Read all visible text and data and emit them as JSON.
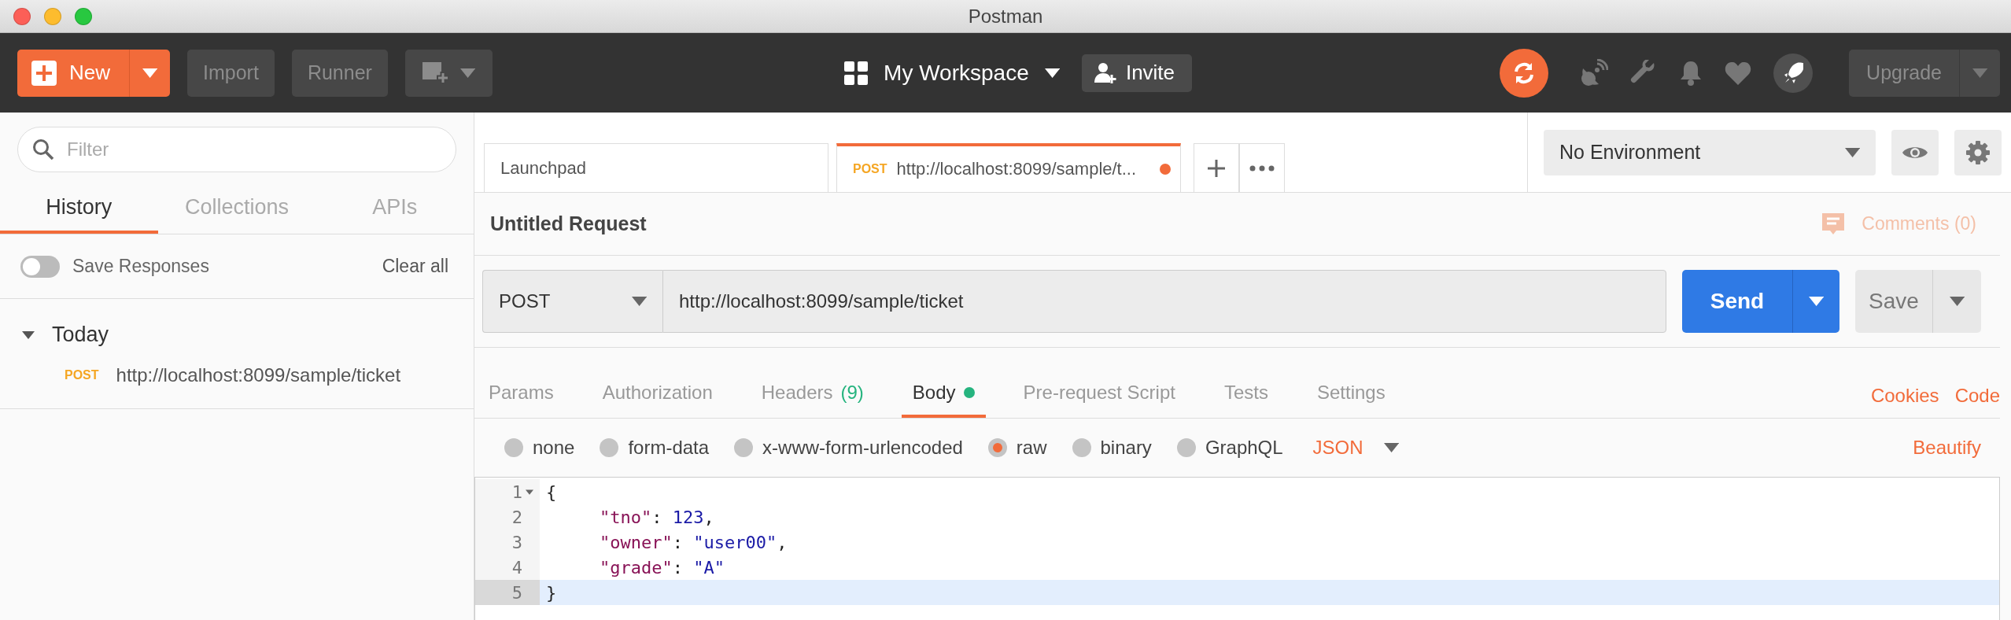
{
  "window": {
    "title": "Postman"
  },
  "toolbar": {
    "new_button": "New",
    "import_button": "Import",
    "runner_button": "Runner",
    "workspace": "My Workspace",
    "invite_button": "Invite",
    "upgrade_button": "Upgrade"
  },
  "sidebar": {
    "filter": {
      "placeholder": "Filter"
    },
    "tabs": [
      {
        "label": "History",
        "selected": true
      },
      {
        "label": "Collections",
        "selected": false
      },
      {
        "label": "APIs",
        "selected": false
      }
    ],
    "save_responses": {
      "label": "Save Responses",
      "on": false
    },
    "clear_all": "Clear all",
    "groups": [
      {
        "label": "Today",
        "expanded": true,
        "items": [
          {
            "method": "POST",
            "url": "http://localhost:8099/sample/ticket"
          }
        ]
      }
    ]
  },
  "request_tabs": [
    {
      "label": "Launchpad",
      "selected": false,
      "unsaved": false
    },
    {
      "method": "POST",
      "label": "http://localhost:8099/sample/t...",
      "selected": true,
      "unsaved": true
    }
  ],
  "environment": {
    "value": "No Environment"
  },
  "request": {
    "title": "Untitled Request",
    "comments": "Comments (0)",
    "method": "POST",
    "url": "http://localhost:8099/sample/ticket",
    "send": "Send",
    "save": "Save"
  },
  "section_tabs": [
    {
      "label": "Params",
      "selected": false,
      "dot": false
    },
    {
      "label": "Authorization",
      "selected": false,
      "dot": false
    },
    {
      "label": "Headers",
      "count": "(9)",
      "selected": false,
      "dot": false
    },
    {
      "label": "Body",
      "selected": true,
      "dot": true
    },
    {
      "label": "Pre-request Script",
      "selected": false,
      "dot": false
    },
    {
      "label": "Tests",
      "selected": false,
      "dot": false
    },
    {
      "label": "Settings",
      "selected": false,
      "dot": false
    }
  ],
  "links": [
    "Cookies",
    "Code"
  ],
  "body_types": [
    {
      "label": "none",
      "selected": false
    },
    {
      "label": "form-data",
      "selected": false
    },
    {
      "label": "x-www-form-urlencoded",
      "selected": false
    },
    {
      "label": "raw",
      "selected": true
    },
    {
      "label": "binary",
      "selected": false
    },
    {
      "label": "GraphQL",
      "selected": false
    }
  ],
  "format": "JSON",
  "beautify": "Beautify",
  "editor": {
    "lines": [
      {
        "number": "1",
        "foldable": true,
        "active": false,
        "tokens": [
          {
            "kind": "punct",
            "text": "{"
          }
        ]
      },
      {
        "number": "2",
        "foldable": false,
        "active": false,
        "tokens": [
          {
            "kind": "key",
            "text": "\"tno\""
          },
          {
            "kind": "punct",
            "text": ": "
          },
          {
            "kind": "number",
            "text": "123"
          },
          {
            "kind": "punct",
            "text": ","
          }
        ]
      },
      {
        "number": "3",
        "foldable": false,
        "active": false,
        "tokens": [
          {
            "kind": "key",
            "text": "\"owner\""
          },
          {
            "kind": "punct",
            "text": ": "
          },
          {
            "kind": "string",
            "text": "\"user00\""
          },
          {
            "kind": "punct",
            "text": ","
          }
        ]
      },
      {
        "number": "4",
        "foldable": false,
        "active": false,
        "tokens": [
          {
            "kind": "key",
            "text": "\"grade\""
          },
          {
            "kind": "punct",
            "text": ": "
          },
          {
            "kind": "string",
            "text": "\"A\""
          }
        ]
      },
      {
        "number": "5",
        "foldable": false,
        "active": true,
        "tokens": [
          {
            "kind": "punct",
            "text": "}"
          }
        ]
      }
    ]
  }
}
